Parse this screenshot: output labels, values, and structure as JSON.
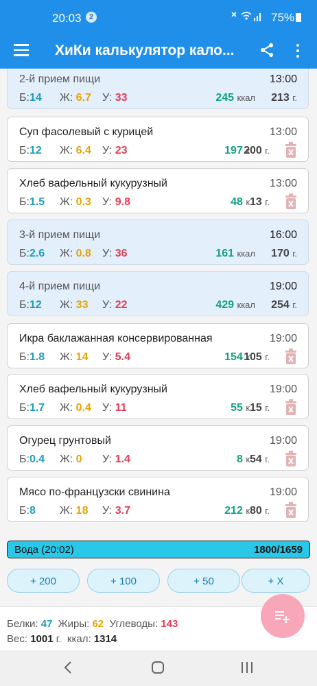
{
  "status": {
    "time": "20:03",
    "notifications": "2",
    "battery": "75%"
  },
  "appbar": {
    "title": "ХиКи калькулятор кало..."
  },
  "labels": {
    "protein": "Б:",
    "fat": "Ж:",
    "carbs": "У:",
    "kcal_full": "ккал",
    "kcal_short": "к",
    "gram": "г."
  },
  "entries": [
    {
      "type": "meal",
      "name": "2-й прием пищи",
      "time": "13:00",
      "b": "14",
      "z": "6.7",
      "u": "33",
      "kcal": "245",
      "weight": "213"
    },
    {
      "type": "food",
      "name": "Суп фасолевый с курицей",
      "time": "13:00",
      "b": "12",
      "z": "6.4",
      "u": "23",
      "kcal": "197",
      "weight": "200"
    },
    {
      "type": "food",
      "name": "Хлеб вафельный кукурузный",
      "time": "13:00",
      "b": "1.5",
      "z": "0.3",
      "u": "9.8",
      "kcal": "48",
      "weight": "13"
    },
    {
      "type": "meal",
      "name": "3-й прием пищи",
      "time": "16:00",
      "b": "2.6",
      "z": "0.8",
      "u": "36",
      "kcal": "161",
      "weight": "170"
    },
    {
      "type": "meal",
      "name": "4-й прием пищи",
      "time": "19:00",
      "b": "12",
      "z": "33",
      "u": "22",
      "kcal": "429",
      "weight": "254"
    },
    {
      "type": "food",
      "name": "Икра баклажанная консервированная",
      "time": "19:00",
      "b": "1.8",
      "z": "14",
      "u": "5.4",
      "kcal": "154",
      "weight": "105"
    },
    {
      "type": "food",
      "name": "Хлеб вафельный кукурузный",
      "time": "19:00",
      "b": "1.7",
      "z": "0.4",
      "u": "11",
      "kcal": "55",
      "weight": "15"
    },
    {
      "type": "food",
      "name": "Огурец грунтовый",
      "time": "19:00",
      "b": "0.4",
      "z": "0",
      "u": "1.4",
      "kcal": "8",
      "weight": "54"
    },
    {
      "type": "food",
      "name": "Мясо по-французски свинина",
      "time": "19:00",
      "b": "8",
      "z": "18",
      "u": "3.7",
      "kcal": "212",
      "weight": "80"
    }
  ],
  "water": {
    "label": "Вода (20:02)",
    "value": "1800/1659",
    "buttons": [
      "+ 200",
      "+ 100",
      "+ 50",
      "+ X"
    ]
  },
  "summary": {
    "protein_label": "Белки:",
    "protein": "47",
    "fat_label": "Жиры:",
    "fat": "62",
    "carbs_label": "Углеводы:",
    "carbs": "143",
    "weight_label": "Вес:",
    "weight": "1001",
    "weight_unit": "г.",
    "kcal_label": "ккал:",
    "kcal": "1314"
  },
  "colors": {
    "primary": "#1f8fea",
    "protein": "#1a9ebb",
    "fat": "#e8a300",
    "carbs": "#e23d55",
    "kcal": "#11a183",
    "water": "#2ac8e8",
    "fab": "#f7a7b8"
  }
}
